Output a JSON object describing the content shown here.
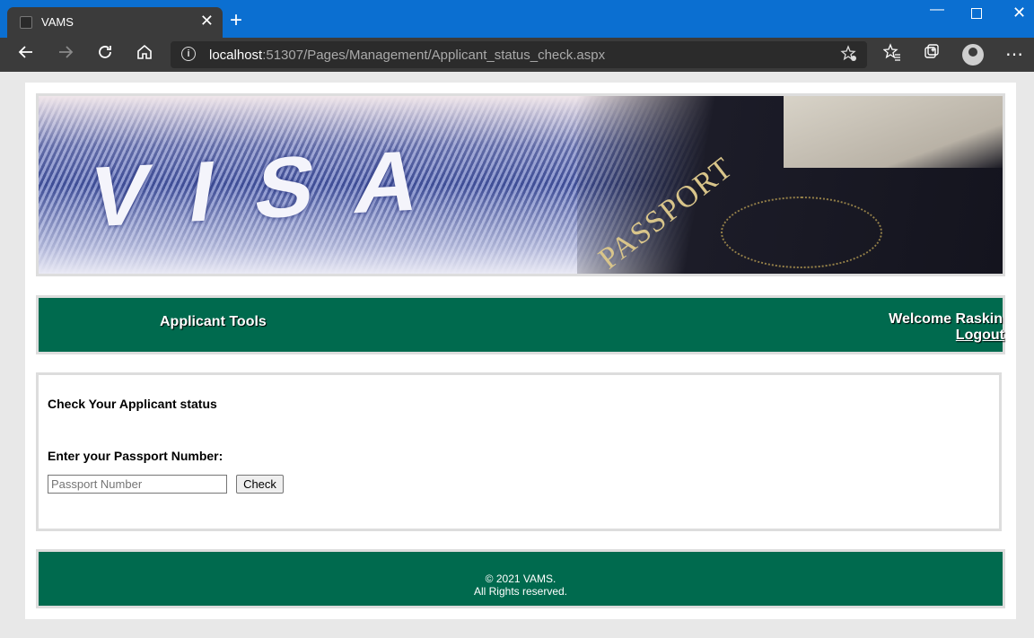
{
  "browser": {
    "tab_title": "VAMS",
    "tab_close": "✕",
    "new_tab": "+",
    "address": {
      "host": "localhost",
      "path": ":51307/Pages/Management/Applicant_status_check.aspx"
    },
    "icons": [
      "back-icon",
      "forward-icon",
      "refresh-icon",
      "home-icon",
      "info-icon",
      "favorite-add-icon",
      "favorites-icon",
      "collections-icon",
      "profile-icon",
      "more-icon"
    ]
  },
  "banner": {
    "visa_word": "VISA",
    "passport_word": "PASSPORT"
  },
  "nav": {
    "title": "Applicant Tools",
    "welcome": "Welcome Raskin",
    "logout": "Logout"
  },
  "content": {
    "title": "Check Your Applicant status",
    "label": "Enter your Passport Number:",
    "passport_placeholder": "Passport Number",
    "passport_value": "",
    "check_button": "Check"
  },
  "footer": {
    "copyright": "© 2021 VAMS.",
    "rights": "All Rights reserved."
  },
  "colors": {
    "brand_green": "#006a4e",
    "titlebar_blue": "#0b6fd1",
    "chrome_dark": "#3b3b3b"
  }
}
